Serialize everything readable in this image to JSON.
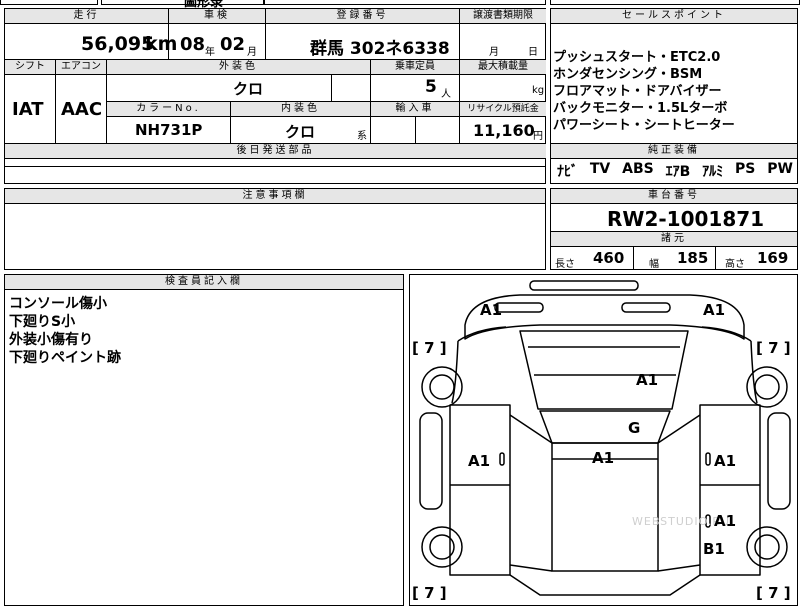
{
  "top_strip": {
    "cut_text": "圖形录"
  },
  "mileage": {
    "header": "走行",
    "value": "56,095",
    "unit": "km"
  },
  "inspection": {
    "header": "車検",
    "year": "08",
    "year_unit": "年",
    "month": "02",
    "month_unit": "月"
  },
  "registration": {
    "header": "登録番号",
    "value": "群馬 302ネ6338"
  },
  "transfer": {
    "header": "譲渡書類期限",
    "month_unit": "月",
    "day_unit": "日"
  },
  "shift": {
    "header": "シフト",
    "value": "IAT"
  },
  "aircon": {
    "header": "エアコン",
    "value": "AAC"
  },
  "exterior_color": {
    "header": "外装色",
    "value": "クロ"
  },
  "seating": {
    "header": "乗車定員",
    "value": "5",
    "unit": "人"
  },
  "max_load": {
    "header": "最大積載量",
    "unit": "kg"
  },
  "color_no": {
    "header": "カラーNo.",
    "value": "NH731P"
  },
  "interior_color": {
    "header": "内装色",
    "value": "クロ",
    "suffix": "系"
  },
  "import": {
    "header": "輸入車"
  },
  "recycle": {
    "header": "リサイクル預託金",
    "value": "11,160",
    "unit": "円"
  },
  "later_parts": {
    "header": "後日発送部品"
  },
  "sales_points": {
    "header": "セールスポイント",
    "lines": [
      "プッシュスタート・ETC2.0",
      "ホンダセンシング・BSM",
      "フロアマット・ドアバイザー",
      "バックモニター・1.5Lターボ",
      "パワーシート・シートヒーター"
    ]
  },
  "equipment": {
    "header": "純正装備",
    "items": [
      "ﾅﾋﾞ",
      "TV",
      "ABS",
      "ｴｱB",
      "ｱﾙﾐ",
      "PS",
      "PW"
    ]
  },
  "notes": {
    "header": "注意事項欄"
  },
  "chassis": {
    "header": "車台番号",
    "value": "RW2-1001871"
  },
  "dimensions": {
    "header": "諸元",
    "length_label": "長さ",
    "length": "460",
    "width_label": "幅",
    "width": "185",
    "height_label": "高さ",
    "height": "169"
  },
  "inspector": {
    "header": "検査員記入欄",
    "lines": [
      "コンソール傷小",
      "下廻りS小",
      "外装小傷有り",
      "下廻りペイント跡"
    ]
  },
  "diagram": {
    "marks": {
      "front_left": "A1",
      "front_right": "A1",
      "tire_fl": "[ 7 ]",
      "tire_fr": "[ 7 ]",
      "hood": "A1",
      "windshield": "G",
      "roof": "A1",
      "door_left": "A1",
      "door_fr": "A1",
      "door_rr": "A1",
      "rear_fender": "B1",
      "tire_rl": "[ 7 ]",
      "tire_rr": "[ 7 ]"
    },
    "watermark": "WEBSTUDIO.RU"
  }
}
